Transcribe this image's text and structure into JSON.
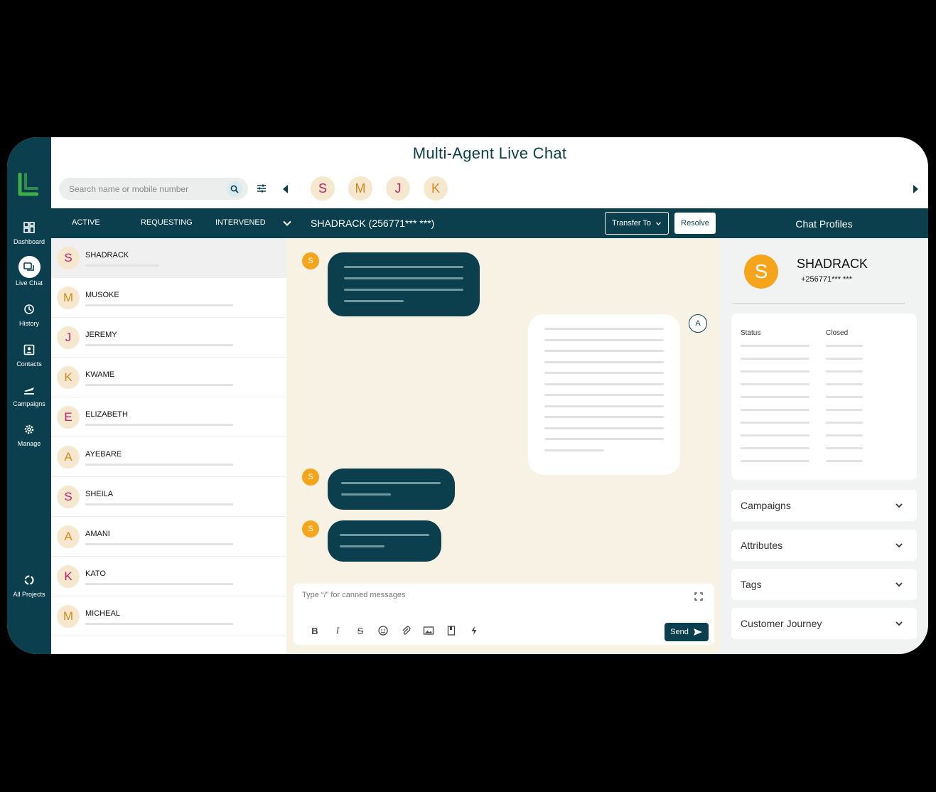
{
  "app": {
    "title": "Multi-Agent Live Chat"
  },
  "nav": {
    "items": [
      {
        "label": "Dashboard",
        "icon": "dashboard-icon"
      },
      {
        "label": "Live Chat",
        "icon": "chat-icon",
        "active": true
      },
      {
        "label": "History",
        "icon": "history-icon"
      },
      {
        "label": "Contacts",
        "icon": "contacts-icon"
      },
      {
        "label": "Campaigns",
        "icon": "campaigns-icon"
      },
      {
        "label": "Manage",
        "icon": "gear-icon"
      }
    ],
    "all_projects": "All Projects"
  },
  "search": {
    "placeholder": "Search name or mobile number"
  },
  "top_agents": [
    "S",
    "M",
    "J",
    "K"
  ],
  "tabs": [
    "ACTIVE",
    "REQUESTING",
    "INTERVENED"
  ],
  "chat_header": {
    "title": "SHADRACK (256771*** ***)",
    "transfer_label": "Transfer To",
    "resolve_label": "Resolve"
  },
  "profiles_title": "Chat Profiles",
  "contacts": [
    {
      "initial": "S",
      "name": "SHADRACK"
    },
    {
      "initial": "M",
      "name": "MUSOKE"
    },
    {
      "initial": "J",
      "name": "JEREMY"
    },
    {
      "initial": "K",
      "name": "KWAME"
    },
    {
      "initial": "E",
      "name": "ELIZABETH"
    },
    {
      "initial": "A",
      "name": "AYEBARE"
    },
    {
      "initial": "S",
      "name": "SHEILA"
    },
    {
      "initial": "A",
      "name": "AMANI"
    },
    {
      "initial": "K",
      "name": "KATO"
    },
    {
      "initial": "M",
      "name": "MICHEAL"
    }
  ],
  "chat": {
    "customer_initial": "S",
    "agent_initial": "A",
    "composer_placeholder": "Type “/” for canned messages",
    "send_label": "Send"
  },
  "profile": {
    "initial": "S",
    "name": "SHADRACK",
    "phone": "+256771*** ***",
    "status_label": "Status",
    "status_value": "Closed",
    "sections": [
      "Campaigns",
      "Attributes",
      "Tags",
      "Customer Journey"
    ]
  },
  "colors": {
    "primary": "#0b3f4d",
    "accent": "#f4a51c",
    "chat_bg": "#f7f2e3",
    "avatar_bg": "#f6e7cf"
  }
}
